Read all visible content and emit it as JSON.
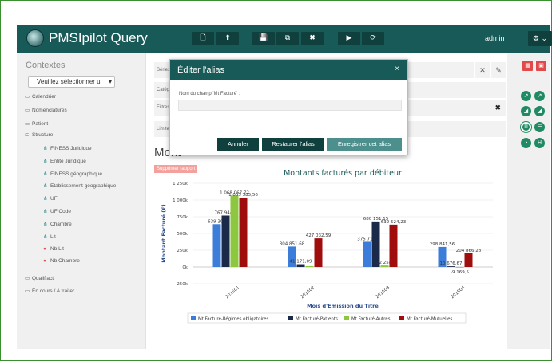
{
  "app": {
    "title": "PMSIpilot Query",
    "user": "admin",
    "toolbar_icons": [
      "file-icon",
      "upload-icon",
      "save-icon",
      "copy-icon",
      "close-icon",
      "play-icon",
      "refresh-icon"
    ],
    "settings_caret": "⌄"
  },
  "sidebar": {
    "heading": "Contextes",
    "select_placeholder": "Veuillez sélectionner u",
    "items": [
      {
        "label": "Calendrier",
        "icon": "folder-icon"
      },
      {
        "label": "Nomenclatures",
        "icon": "folder-icon"
      },
      {
        "label": "Patient",
        "icon": "folder-icon"
      },
      {
        "label": "Structure",
        "icon": "folder-open-icon"
      },
      {
        "label": "FINESS Juridique",
        "icon": "hierarchy-icon"
      },
      {
        "label": "Entité Juridique",
        "icon": "hierarchy-icon"
      },
      {
        "label": "FINESS géographique",
        "icon": "hierarchy-icon"
      },
      {
        "label": "Etablissement géographique",
        "icon": "hierarchy-icon"
      },
      {
        "label": "UF",
        "icon": "hierarchy-icon"
      },
      {
        "label": "UF Code",
        "icon": "hierarchy-icon"
      },
      {
        "label": "Chambre",
        "icon": "hierarchy-icon"
      },
      {
        "label": "Lit",
        "icon": "hierarchy-icon"
      },
      {
        "label": "Nb Lit",
        "icon": "measure-icon"
      },
      {
        "label": "Nb Chambre",
        "icon": "measure-icon"
      },
      {
        "label": "Qualifiact",
        "icon": "folder-icon"
      },
      {
        "label": "En cours / A traiter",
        "icon": "folder-icon"
      }
    ]
  },
  "query": {
    "row_labels": [
      "Séries",
      "Catégo",
      "Filtres",
      "Limite"
    ],
    "title": "Mont",
    "delete_report": "Supprimer rapport"
  },
  "modal": {
    "title": "Éditer l'alias",
    "field_label": "Nom du champ 'Mt Facturé' :",
    "field_value": "",
    "cancel": "Annuler",
    "restore": "Restaurer l'alias",
    "save": "Enregistrer cet alias"
  },
  "colors": {
    "brand": "#175a57",
    "series_1": "#3b7dd8",
    "series_2": "#1c2a4a",
    "series_3": "#8dc63f",
    "series_4": "#a00d0d"
  },
  "chart_data": {
    "type": "bar",
    "title": "Montants facturés par débiteur",
    "xlabel": "Mois d'Emission du Titre",
    "ylabel": "Montant Facturé (€)",
    "ylim": [
      -250000,
      1250000
    ],
    "yticks": [
      -250000,
      0,
      250000,
      500000,
      750000,
      1000000,
      1250000
    ],
    "ytick_labels": [
      "-250k",
      "0k",
      "250k",
      "500k",
      "750k",
      "1 000k",
      "1 250k"
    ],
    "categories": [
      "201501",
      "201502",
      "201503",
      "201504"
    ],
    "series": [
      {
        "name": "Mt Facturé-Régimes obligatoires",
        "values": [
          639304,
          304851.68,
          375717,
          298841.56
        ]
      },
      {
        "name": "Mt Facturé-Patients",
        "values": [
          767944,
          41171.09,
          680151.15,
          10676.67
        ]
      },
      {
        "name": "Mt Facturé-Autres",
        "values": [
          1068067,
          13000,
          22258,
          -9169.5
        ]
      },
      {
        "name": "Mt Facturé-Mutuelles",
        "values": [
          1033385.56,
          427032.59,
          632524.23,
          204866.28
        ]
      }
    ],
    "data_labels": [
      [
        "639 304",
        "767 944,3",
        "1 068 067,72",
        "1 033 385,56"
      ],
      [
        "304 851,68",
        "41 171,09",
        "",
        "427 032,59"
      ],
      [
        "375 717,",
        "680 151,15",
        "22 258,",
        "632 524,23"
      ],
      [
        "298 841,56",
        "10 676,67",
        "-9 169,5",
        "204 866,28"
      ]
    ],
    "legend_position": "bottom"
  }
}
